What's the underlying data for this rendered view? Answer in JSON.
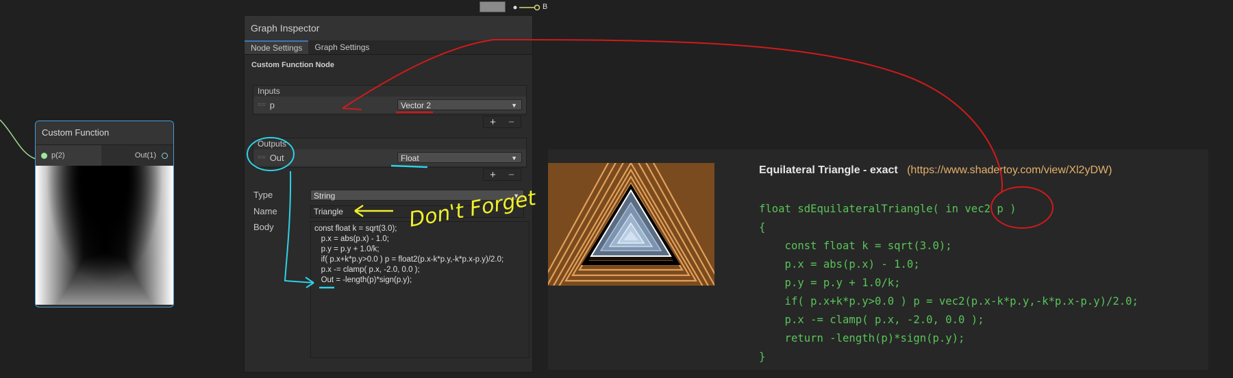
{
  "node": {
    "title": "Custom Function",
    "input_port": "p(2)",
    "output_port": "Out(1)"
  },
  "inspector": {
    "title": "Graph Inspector",
    "tabs": [
      {
        "label": "Node Settings",
        "active": true
      },
      {
        "label": "Graph Settings",
        "active": false
      }
    ],
    "section_title": "Custom Function Node",
    "inputs": {
      "header": "Inputs",
      "rows": [
        {
          "name": "p",
          "type": "Vector 2"
        }
      ]
    },
    "outputs": {
      "header": "Outputs",
      "rows": [
        {
          "name": "Out",
          "type": "Float"
        }
      ]
    },
    "add_symbol": "+",
    "remove_symbol": "−",
    "type_label": "Type",
    "type_value": "String",
    "name_label": "Name",
    "name_value": "Triangle",
    "body_label": "Body",
    "body_code": "const float k = sqrt(3.0);\n   p.x = abs(p.x) - 1.0;\n   p.y = p.y + 1.0/k;\n   if( p.x+k*p.y>0.0 ) p = float2(p.x-k*p.y,-k*p.x-p.y)/2.0;\n   p.x -= clamp( p.x, -2.0, 0.0 );\n   Out = -length(p)*sign(p.y);"
  },
  "annotation_text": "Don't Forget",
  "reference": {
    "title": "Equilateral Triangle - exact",
    "url_text": "(https://www.shadertoy.com/view/Xl2yDW)",
    "code": "float sdEquilateralTriangle( in vec2 p )\n{\n    const float k = sqrt(3.0);\n    p.x = abs(p.x) - 1.0;\n    p.y = p.y + 1.0/k;\n    if( p.x+k*p.y>0.0 ) p = vec2(p.x-k*p.y,-k*p.x-p.y)/2.0;\n    p.x -= clamp( p.x, -2.0, 0.0 );\n    return -length(p)*sign(p.y);\n}"
  },
  "top_fragment_label": "B",
  "colors": {
    "accent": "#3a79bb",
    "annotation_red": "#d11a1a",
    "annotation_cyan": "#2fd2e6",
    "annotation_yellow": "#f0f02a",
    "code_green": "#59c459",
    "url_orange": "#e6b06a"
  }
}
